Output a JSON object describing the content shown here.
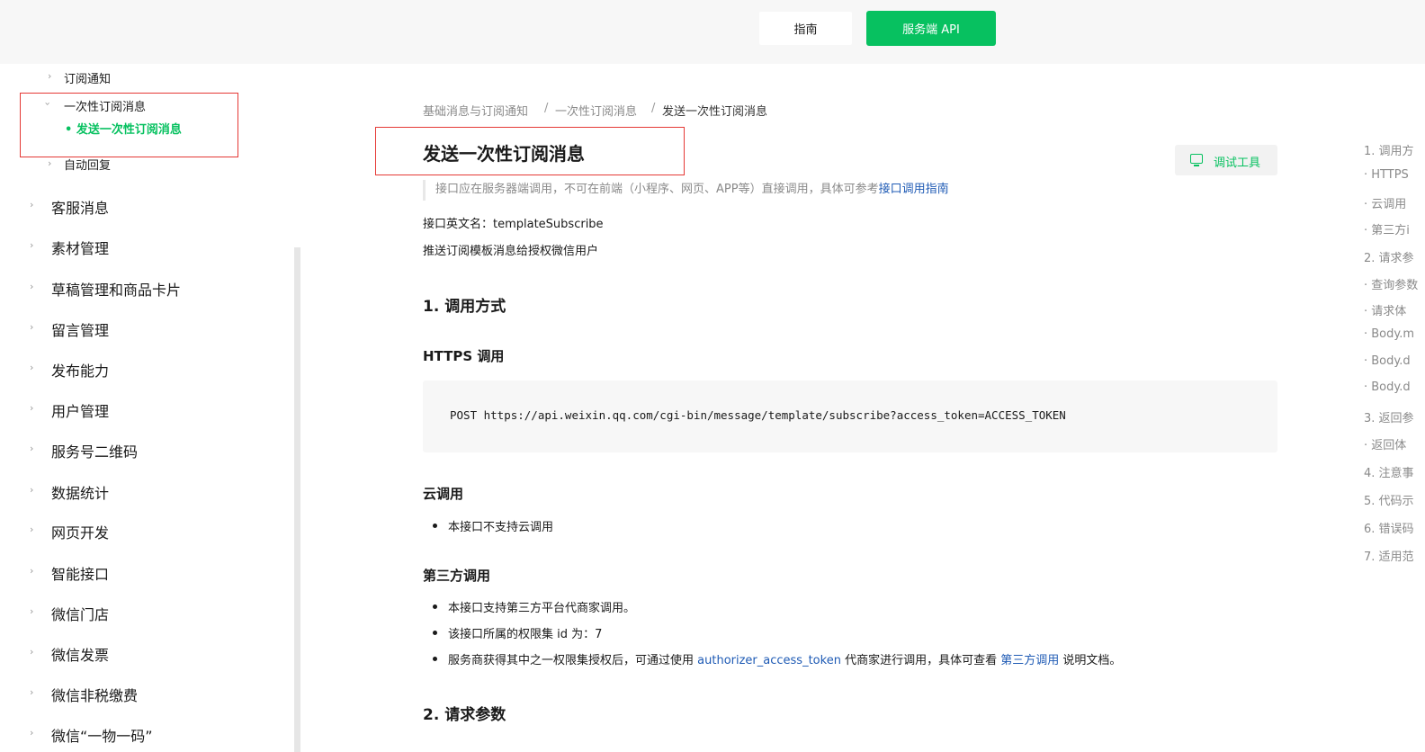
{
  "header": {
    "guide_label": "指南",
    "api_label": "服务端 API"
  },
  "sidebar": {
    "sub_items": [
      {
        "label": "订阅通知"
      },
      {
        "label": "一次性订阅消息"
      },
      {
        "label": "自动回复"
      }
    ],
    "active_item": "• 发送一次性订阅消息",
    "items": [
      {
        "label": "客服消息"
      },
      {
        "label": "素材管理"
      },
      {
        "label": "草稿管理和商品卡片"
      },
      {
        "label": "留言管理"
      },
      {
        "label": "发布能力"
      },
      {
        "label": "用户管理"
      },
      {
        "label": "服务号二维码"
      },
      {
        "label": "数据统计"
      },
      {
        "label": "网页开发"
      },
      {
        "label": "智能接口"
      },
      {
        "label": "微信门店"
      },
      {
        "label": "微信发票"
      },
      {
        "label": "微信非税缴费"
      },
      {
        "label": "微信“一物一码”"
      }
    ]
  },
  "breadcrumb": {
    "items": [
      "基础消息与订阅通知",
      "一次性订阅消息"
    ],
    "separator": "/",
    "current": "发送一次性订阅消息"
  },
  "main": {
    "title": "发送一次性订阅消息",
    "debug_button": "调试工具",
    "note_text": "接口应在服务器端调用，不可在前端（小程序、网页、APP等）直接调用，具体可参考",
    "note_link": "接口调用指南",
    "api_name": "接口英文名：templateSubscribe",
    "description": "推送订阅模板消息给授权微信用户",
    "section1": "1. 调用方式",
    "https_heading": "HTTPS 调用",
    "code": "POST https://api.weixin.qq.com/cgi-bin/message/template/subscribe?access_token=ACCESS_TOKEN",
    "cloud_heading": "云调用",
    "cloud_bullet": "本接口不支持云调用",
    "third_heading": "第三方调用",
    "third_bullet1": "本接口支持第三方平台代商家调用。",
    "third_bullet2": "该接口所属的权限集 id 为：7",
    "third_bullet3_a": "服务商获得其中之一权限集授权后，可通过使用",
    "third_bullet3_token": "authorizer_access_token",
    "third_bullet3_b": "代商家进行调用，具体可查看",
    "third_bullet3_link": "第三方调用",
    "third_bullet3_c": "说明文档。",
    "section2": "2. 请求参数"
  },
  "toc": {
    "items": [
      "1. 调用方",
      "· HTTPS",
      "· 云调用",
      "· 第三方i",
      "2. 请求参",
      "· 查询参数",
      "· 请求体",
      "· Body.m",
      "· Body.d",
      "· Body.d",
      "3. 返回参",
      "· 返回体",
      "4. 注意事",
      "5. 代码示",
      "6. 错误码",
      "7. 适用范"
    ]
  }
}
